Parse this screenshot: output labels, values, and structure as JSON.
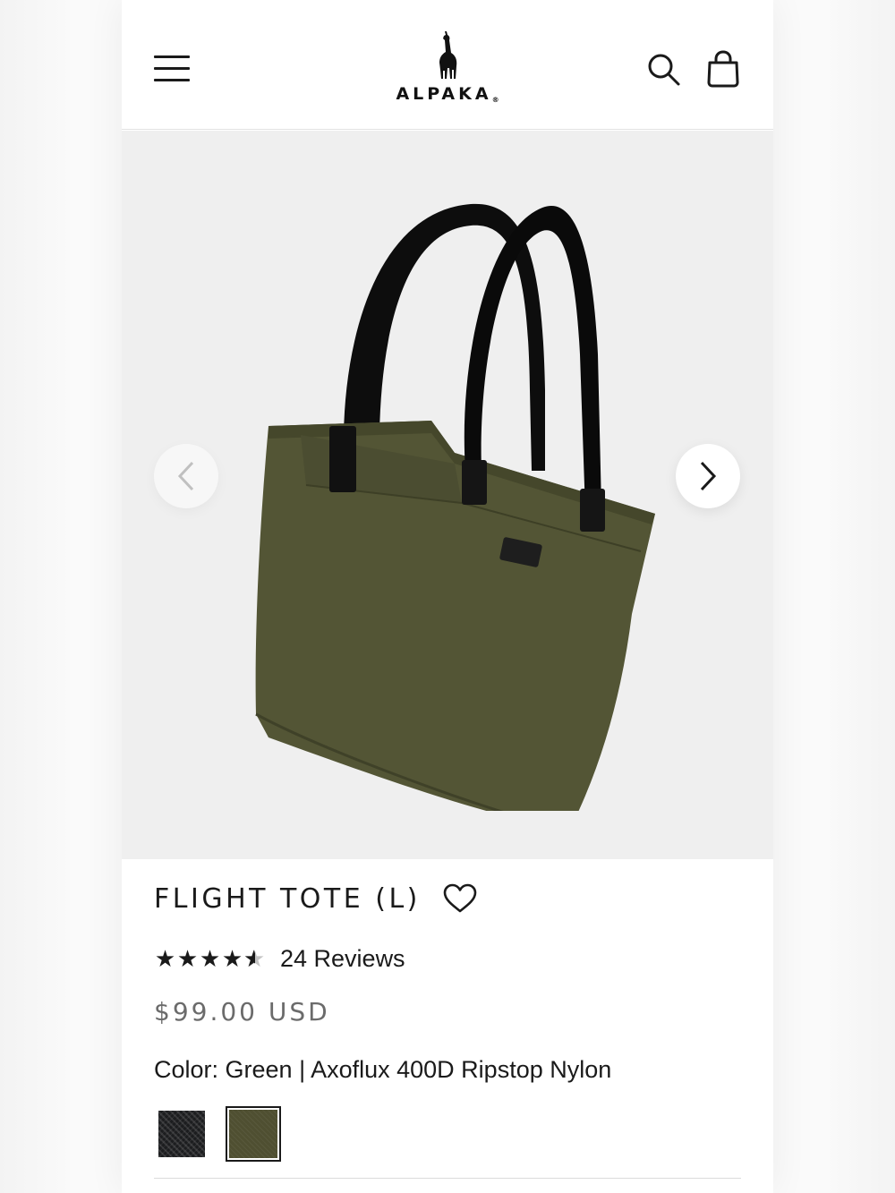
{
  "header": {
    "brand": "ALPAKA",
    "brand_mark": "®",
    "menu_icon": "hamburger-menu-icon",
    "search_icon": "search-icon",
    "cart_icon": "shopping-bag-icon"
  },
  "gallery": {
    "image_alt": "Flight Tote (L) in green",
    "prev_icon": "chevron-left-icon",
    "next_icon": "chevron-right-icon"
  },
  "product": {
    "title": "FLIGHT TOTE (L)",
    "wishlist_icon": "heart-icon",
    "rating": 4.5,
    "rating_max": 5,
    "reviews_label": "24 Reviews",
    "price": "$99.00 USD",
    "color_label": "Color: Green | Axoflux 400D Ripstop Nylon",
    "swatches": [
      {
        "name": "Black",
        "color": "#1c1d1f",
        "selected": false
      },
      {
        "name": "Green",
        "color": "#4f4f31",
        "selected": true
      }
    ]
  },
  "colors": {
    "text": "#1a1a1a",
    "price": "#6b6b6b",
    "gallery_bg": "#efefef",
    "bag_body": "#4f5133",
    "strap": "#111111"
  }
}
